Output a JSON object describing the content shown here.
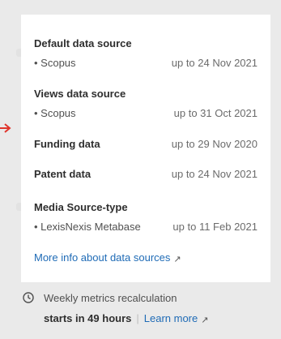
{
  "sources": {
    "default": {
      "heading": "Default data source",
      "item": "• Scopus",
      "date": "up to 24 Nov 2021"
    },
    "views": {
      "heading": "Views data source",
      "item": "• Scopus",
      "date": "up to 31 Oct 2021"
    },
    "funding": {
      "heading": "Funding data",
      "date": "up to 29 Nov 2020"
    },
    "patent": {
      "heading": "Patent data",
      "date": "up to 24 Nov 2021"
    },
    "media": {
      "heading": "Media Source-type",
      "item": "• LexisNexis Metabase",
      "date": "up to 11 Feb 2021"
    }
  },
  "more_info": {
    "label": "More info about data sources",
    "icon": "external-link-icon"
  },
  "footer": {
    "clock_icon": "clock-icon",
    "line1": "Weekly metrics recalculation",
    "line2_bold": "starts in 49 hours",
    "separator": "|",
    "learn_more": "Learn more",
    "learn_icon": "external-link-icon"
  },
  "colors": {
    "accent": "#1f6bb6",
    "arrow": "#e0342b",
    "panel": "#ffffff",
    "background": "#eaeaea"
  }
}
